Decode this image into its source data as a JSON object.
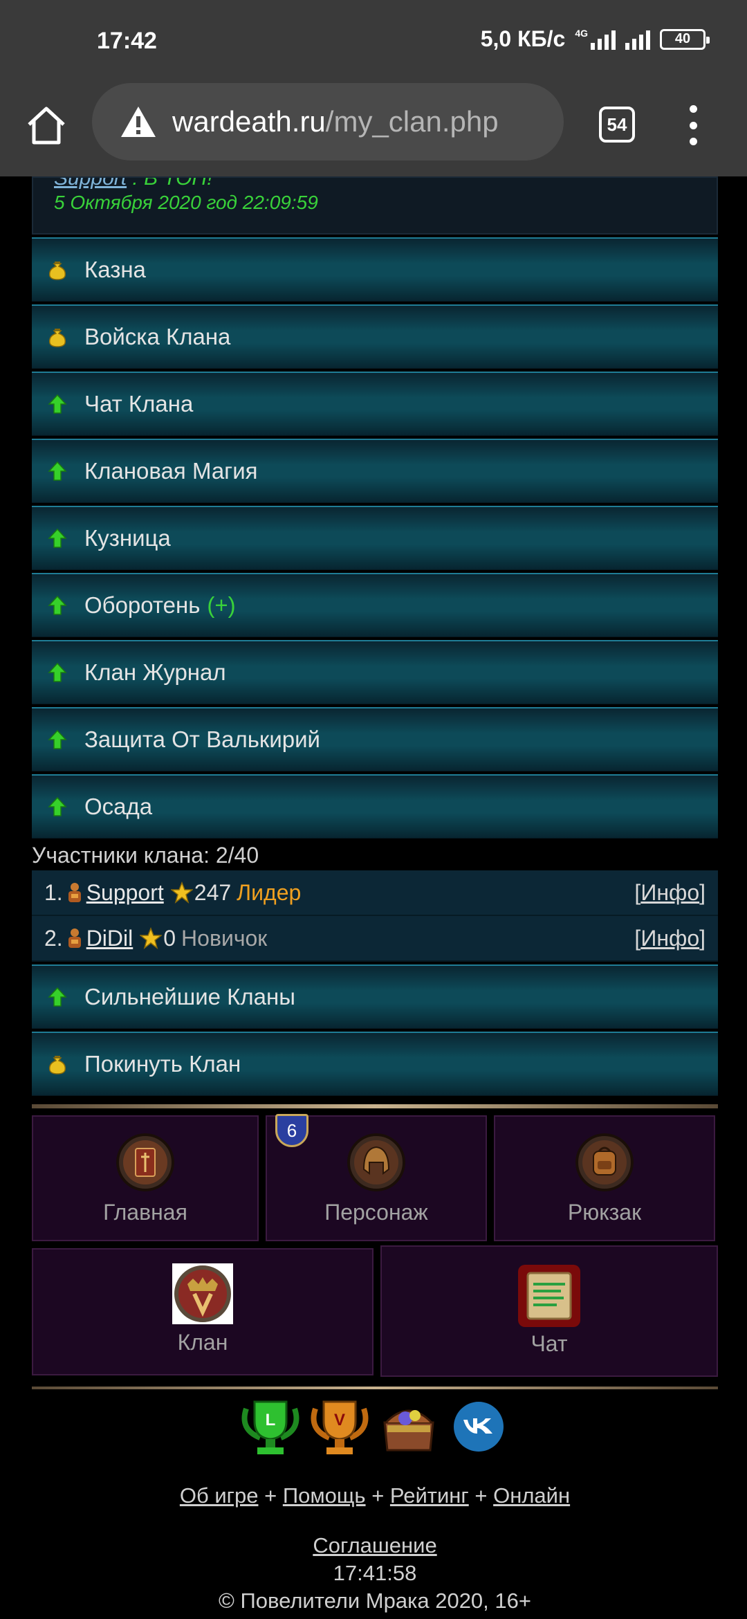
{
  "status_bar": {
    "time": "17:42",
    "speed": "5,0 КБ/с",
    "network": "4G",
    "battery": "40"
  },
  "browser": {
    "url_host": "wardeath.ru",
    "url_path": "/my_clan.php",
    "tab_count": "54"
  },
  "news": {
    "author": "Support",
    "text": " : В ТОП!",
    "date": "5 Октября 2020 год 22:09:59"
  },
  "menu": [
    {
      "label": "Казна",
      "icon": "money-bag-icon"
    },
    {
      "label": "Войска Клана",
      "icon": "money-bag-icon"
    },
    {
      "label": "Чат Клана",
      "icon": "green-arrow-up-icon"
    },
    {
      "label": "Клановая Магия",
      "icon": "green-arrow-up-icon"
    },
    {
      "label": "Кузница",
      "icon": "green-arrow-up-icon"
    },
    {
      "label": "Оборотень",
      "icon": "green-arrow-up-icon",
      "extra": "(+)"
    },
    {
      "label": "Клан Журнал",
      "icon": "green-arrow-up-icon"
    },
    {
      "label": "Защита От Валькирий",
      "icon": "green-arrow-up-icon"
    },
    {
      "label": "Осада",
      "icon": "green-arrow-up-icon"
    }
  ],
  "members": {
    "title": "Участники клана: 2/40",
    "list": [
      {
        "num": "1.",
        "name": "Support",
        "score": "247",
        "rank": "Лидер",
        "info": "Инфо"
      },
      {
        "num": "2.",
        "name": "DiDil",
        "score": "0",
        "rank": "Новичок",
        "info": "Инфо"
      }
    ]
  },
  "menu2": [
    {
      "label": "Сильнейшие Кланы",
      "icon": "green-arrow-up-icon"
    },
    {
      "label": "Покинуть Клан",
      "icon": "money-bag-icon"
    }
  ],
  "nav": {
    "main": "Главная",
    "character": "Персонаж",
    "character_badge": "6",
    "backpack": "Рюкзак",
    "clan": "Клан",
    "chat": "Чат"
  },
  "footer": {
    "about": "Об игре",
    "help": "Помощь",
    "rating": "Рейтинг",
    "online": "Онлайн",
    "separator": "+",
    "agreement": "Соглашение",
    "server_time": "17:41:58",
    "copyright": "© Повелители Мрака 2020, 16+"
  },
  "colors": {
    "accent_green": "#39d23a",
    "leader_orange": "#f0a020",
    "menu_teal": "#0d4a58"
  }
}
